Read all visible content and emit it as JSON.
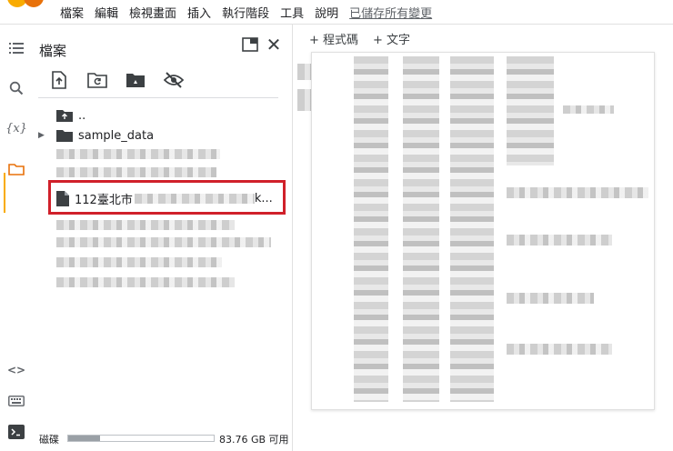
{
  "menu": {
    "items": [
      "檔案",
      "編輯",
      "檢視畫面",
      "插入",
      "執行階段",
      "工具",
      "說明"
    ],
    "saved_status": "已儲存所有變更"
  },
  "colors": {
    "accent": "#f9ab00",
    "highlight": "#d0202a",
    "logo_orange": "#f9ab00",
    "logo_red": "#e8710a"
  },
  "rail": {
    "icons": [
      "list-icon",
      "search-icon",
      "variables-icon",
      "folder-icon",
      "code-icon",
      "keyboard-icon",
      "terminal-icon"
    ],
    "variables_label": "{x}",
    "code_label": "<>"
  },
  "files": {
    "title": "檔案",
    "toolbar_icons": [
      "upload-icon",
      "refresh-icon",
      "drive-icon",
      "hide-icon"
    ],
    "parent_dir": "..",
    "folder": "sample_data",
    "highlighted_file": "112臺北市",
    "highlighted_file_suffix": "k..."
  },
  "disk": {
    "label": "磁碟",
    "free": "83.76 GB 可用",
    "used_fraction": 0.22
  },
  "content": {
    "add_code": "+ 程式碼",
    "add_text": "+ 文字"
  }
}
